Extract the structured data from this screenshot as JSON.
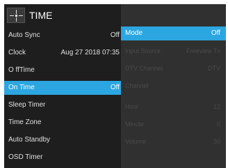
{
  "header": {
    "title": "TIME",
    "icon": "clock-crosshair-icon"
  },
  "menu": [
    {
      "label": "Auto Sync",
      "value": "Off"
    },
    {
      "label": "Clock",
      "value": "Aug 27 2018 07:35"
    },
    {
      "label": "O ffTime",
      "value": ""
    },
    {
      "label": "On Time",
      "value": "Off"
    },
    {
      "label": "Sleep Timer",
      "value": ""
    },
    {
      "label": "Time Zone",
      "value": ""
    },
    {
      "label": "Auto Standby",
      "value": ""
    },
    {
      "label": "OSD Timer",
      "value": ""
    }
  ],
  "submenu": [
    {
      "label": "Mode",
      "value": "Off"
    },
    {
      "label": "Input Source",
      "value": "Freeview Tv"
    },
    {
      "label": "DTV Channel",
      "value": "DTV"
    },
    {
      "label": "Channel",
      "value": ""
    },
    {
      "label": "Hour",
      "value": "12"
    },
    {
      "label": "Minute",
      "value": "0"
    },
    {
      "label": "Volume",
      "value": "30"
    }
  ],
  "colors": {
    "selection": "#2ba6e0",
    "panel_left": "#1e1e1e",
    "panel_right": "#303030"
  }
}
